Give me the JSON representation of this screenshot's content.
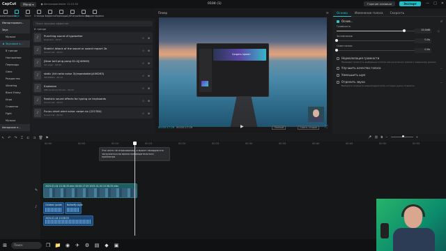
{
  "titlebar": {
    "logo": "CapCut",
    "menu": "Меню ▾",
    "autosave": "● Автосохранение: 11:21:52",
    "project": "0104 (1)",
    "hotkeys": "Горячие клавиши",
    "export": "Экспорт",
    "controls": [
      "—",
      "□",
      "✕"
    ]
  },
  "toolbar": {
    "items": [
      {
        "label": "Медиаматериалы",
        "active": false
      },
      {
        "label": "Звук",
        "active": true
      },
      {
        "label": "Текст",
        "active": false
      },
      {
        "label": "Стикеры",
        "active": false
      },
      {
        "label": "Эффекты",
        "active": false
      },
      {
        "label": "Переходы",
        "active": false
      },
      {
        "label": "Субтитры",
        "active": false
      },
      {
        "label": "Фильтры",
        "active": false
      },
      {
        "label": "Корректировка",
        "active": false
      }
    ]
  },
  "nav": {
    "items": [
      {
        "label": "Импортирован...",
        "kind": "head"
      },
      {
        "label": "Звук",
        "kind": "head"
      },
      {
        "label": "Музыка",
        "kind": "item"
      },
      {
        "label": "Звуковые э...",
        "kind": "active"
      },
      {
        "label": "В тренде",
        "kind": "item"
      },
      {
        "label": "Настроение",
        "kind": "item"
      },
      {
        "label": "Переходы",
        "kind": "item"
      },
      {
        "label": "Смех",
        "kind": "item"
      },
      {
        "label": "Рождество",
        "kind": "item"
      },
      {
        "label": "Vibrating",
        "kind": "item"
      },
      {
        "label": "Black Friday",
        "kind": "item"
      },
      {
        "label": "Игра",
        "kind": "item"
      },
      {
        "label": "Стоматол",
        "kind": "item"
      },
      {
        "label": "Fight",
        "kind": "item"
      },
      {
        "label": "Музыка",
        "kind": "item"
      },
      {
        "label": "Авторские п...",
        "kind": "head"
      }
    ]
  },
  "media": {
    "search_placeholder": "Поиск звуковых эффектов",
    "section": "В тренде",
    "sounds": [
      {
        "title": "Punching sound of typewriter",
        "sub": "Rolandsh · 00:01"
      },
      {
        "title": "Shakin! Attack of the sword or sword impact 2b",
        "sub": "Sound Cat · 00:01"
      },
      {
        "title": "[Door bell ping pong 02-4](40649)",
        "sub": "Ido Logic · 00:04"
      },
      {
        "title": "static (hit radio noise 3)(repeatable)(406263)",
        "sub": "SOUNDDD · 00:12"
      },
      {
        "title": "Explosion",
        "sub": "Official Sound Studio · 00:04"
      },
      {
        "title": "Realistic sound effects for typing on keyboards",
        "sub": "Sound Cat · 00:03"
      },
      {
        "title": "Fuuuu short wind noise: swipe six (222784)",
        "sub": "Sound Cat · 00:01"
      }
    ]
  },
  "player": {
    "title": "Плеер",
    "current": "00:00:17:29",
    "total": "00:00:17:29",
    "format": "Полный",
    "ratio": "Соотн. сторон",
    "screen_hero": "Создать проект"
  },
  "props": {
    "tabs": [
      "Основа",
      "Изменение голоса",
      "Скорость"
    ],
    "active_tab": 0,
    "section_title": "Основ...",
    "reset": "↺",
    "volume": {
      "label": "Громкость",
      "value": "10.0dB",
      "level": 0.82
    },
    "fade_in": {
      "label": "Затемнение",
      "value": "0.0s",
      "level": 0
    },
    "fade_out": {
      "label": "Осветление",
      "value": "0.0s",
      "level": 0
    },
    "toggles": [
      {
        "label": "Нормализация громкости",
        "on": false,
        "chev": false,
        "desc": "Приведет громкость выбранных клипов или нескольких клипов к заданному уровню"
      },
      {
        "label": "Улучшить качество голоса",
        "on": false,
        "chev": true,
        "desc": ""
      },
      {
        "label": "Уменьшить шум",
        "on": false,
        "chev": false,
        "desc": ""
      },
      {
        "label": "Отделить звуки",
        "on": false,
        "chev": true,
        "desc": "Выберите элементы видео/аудиоклипа, которые нужно отделить"
      }
    ]
  },
  "timeline": {
    "ruler": [
      "00:00",
      "00:05",
      "00:10",
      "00:15",
      "00:20",
      "00:25",
      "00:30",
      "00:35",
      "00:40",
      "00:45",
      "00:50",
      "00:55"
    ],
    "tooltip": "Эта часть не отрисовалась и может некорректно загружаться во время предварительного просмотра",
    "video_clip": "2025-01-04 10-58-33.mkv   00:00:17:29  2025-01-04 10-58-33.mkv",
    "audio_a": "Children jacket",
    "audio_b": "Butterfly style",
    "audio_c": "2025-01-04 10:58:33"
  },
  "taskbar": {
    "search": "Поиск",
    "icons": [
      "windows-icon",
      "task-view-icon",
      "explorer-icon",
      "browser-icon",
      "telegram-icon",
      "steam-icon",
      "files-icon",
      "app-icon",
      "capcut-icon"
    ]
  }
}
